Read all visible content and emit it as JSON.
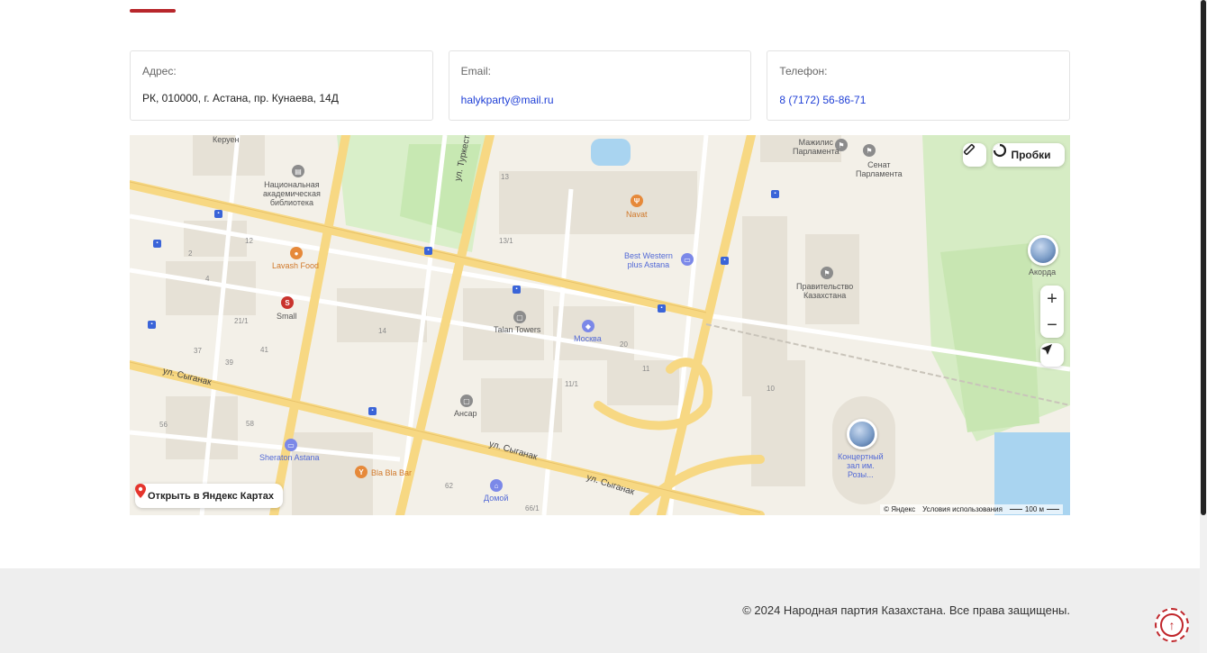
{
  "contacts": {
    "address_label": "Адрес:",
    "address_value": "РК, 010000, г. Астана, пр. Кунаева, 14Д",
    "email_label": "Email:",
    "email_value": "halykparty@mail.ru",
    "phone_label": "Телефон:",
    "phone_value": "8 (7172) 56-86-71"
  },
  "map": {
    "traffic_label": "Пробки",
    "open_in_yandex": "Открыть в Яндекс Картах",
    "attribution": "© Яндекс",
    "terms": "Условия использования",
    "scale": "100 м",
    "zoom_in": "+",
    "zoom_out": "−",
    "labels": {
      "keruen": "Керуен",
      "library": "Национальная\nакадемическая\nбиблиотека",
      "lavash": "Lavash Food",
      "small": "Small",
      "turkestan": "ул. Туркестан",
      "navat": "Navat",
      "best_western": "Best Western\nplus Astana",
      "talan": "Talan Towers",
      "moskva": "Москва",
      "ansar": "Ансар",
      "syganak1": "ул. Сыганак",
      "syganak2": "ул. Сыганак",
      "syganak3": "ул. Сыганак",
      "sheraton": "Sheraton Astana",
      "blablabar": "Bla Bla Bar",
      "domoi": "Домой",
      "mazhilis": "Мажилис\nПарламента",
      "senat": "Сенат\nПарламента",
      "government": "Правительство\nКазахстана",
      "akorda": "Акорда",
      "concert": "Концертный\nзал им.\nРозы..."
    },
    "numbers": [
      "13",
      "13/1",
      "12",
      "2",
      "4",
      "21/1",
      "37",
      "41",
      "39",
      "14",
      "20",
      "11",
      "11/1",
      "10",
      "56",
      "58",
      "62",
      "66/1"
    ]
  },
  "footer": {
    "copyright": "© 2024 Народная партия Казахстана. Все права защищены."
  },
  "colors": {
    "accent": "#b8262b",
    "link": "#1f3fd6",
    "road_major": "#f7d883",
    "footer_bg": "#eeeeee"
  }
}
